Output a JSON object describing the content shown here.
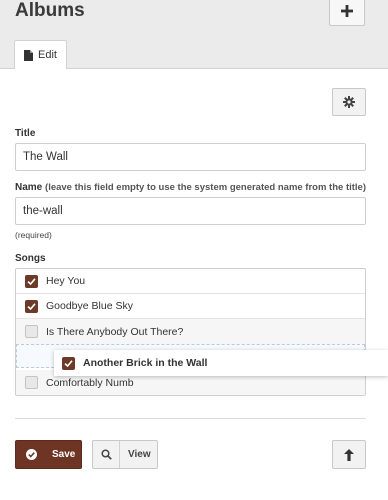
{
  "header": {
    "title": "Albums",
    "add_icon": "plus-icon"
  },
  "tabs": [
    {
      "label": "Edit",
      "icon": "document-icon",
      "active": true
    }
  ],
  "toolbar": {
    "settings_icon": "gear-icon"
  },
  "form": {
    "title": {
      "label": "Title",
      "value": "The Wall"
    },
    "name": {
      "label": "Name",
      "hint": "(leave this field empty to use the system generated name from the title)",
      "value": "the-wall",
      "required_note": "(required)"
    },
    "songs": {
      "label": "Songs",
      "items": [
        {
          "label": "Hey You",
          "checked": true
        },
        {
          "label": "Goodbye Blue Sky",
          "checked": true
        },
        {
          "label": "Is There Anybody Out There?",
          "checked": false
        },
        {
          "label": "Comfortably Numb",
          "checked": false
        }
      ],
      "dragging": {
        "label": "Another Brick in the Wall",
        "checked": true
      }
    }
  },
  "actions": {
    "save_label": "Save",
    "view_label": "View",
    "up_icon": "arrow-up-icon"
  },
  "colors": {
    "accent": "#6e3524",
    "checkbox": "#6b3b28",
    "header_bg": "#ebebeb"
  }
}
